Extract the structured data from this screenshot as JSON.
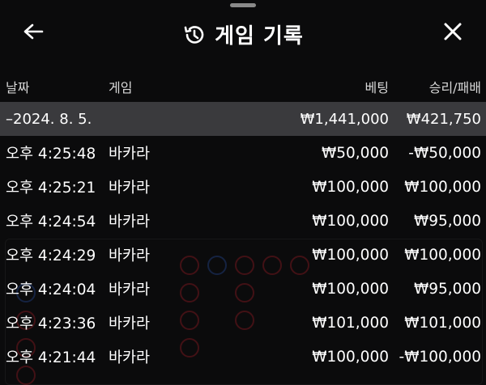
{
  "header": {
    "title": "게임 기록",
    "back_icon": "arrow-left-icon",
    "history_icon": "history-icon",
    "close_icon": "close-icon"
  },
  "columns": {
    "date": "날짜",
    "game": "게임",
    "bet": "베팅",
    "result": "승리/패배"
  },
  "group": {
    "date": "–2024. 8. 5.",
    "bet": "₩1,441,000",
    "result": "₩421,750"
  },
  "rows": [
    {
      "time": "오후 4:25:48",
      "game": "바카라",
      "bet": "₩50,000",
      "result": "-₩50,000"
    },
    {
      "time": "오후 4:25:21",
      "game": "바카라",
      "bet": "₩100,000",
      "result": "₩100,000"
    },
    {
      "time": "오후 4:24:54",
      "game": "바카라",
      "bet": "₩100,000",
      "result": "₩95,000"
    },
    {
      "time": "오후 4:24:29",
      "game": "바카라",
      "bet": "₩100,000",
      "result": "₩100,000"
    },
    {
      "time": "오후 4:24:04",
      "game": "바카라",
      "bet": "₩100,000",
      "result": "₩95,000"
    },
    {
      "time": "오후 4:23:36",
      "game": "바카라",
      "bet": "₩101,000",
      "result": "₩101,000"
    },
    {
      "time": "오후 4:21:44",
      "game": "바카라",
      "bet": "₩100,000",
      "result": "-₩100,000"
    }
  ],
  "colors": {
    "background": "#0b0b0c",
    "group_row": "#3a3a3d",
    "text": "#ffffff"
  }
}
